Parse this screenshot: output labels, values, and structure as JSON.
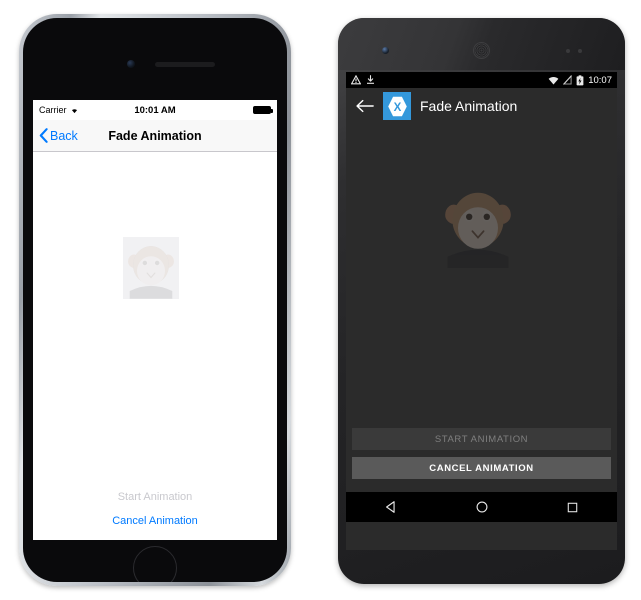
{
  "ios": {
    "status": {
      "carrier": "Carrier",
      "wifi_icon": "wifi-icon",
      "time": "10:01 AM",
      "battery_icon": "battery-icon"
    },
    "nav": {
      "back_label": "Back",
      "back_icon": "chevron-left-icon",
      "title": "Fade Animation"
    },
    "content": {
      "image_name": "monkey-image"
    },
    "buttons": {
      "start_label": "Start Animation",
      "start_enabled": false,
      "cancel_label": "Cancel Animation",
      "cancel_enabled": true
    },
    "colors": {
      "tint": "#007aff",
      "disabled_text": "#c9c9ce",
      "nav_bg": "#f8f8f8",
      "screen_bg": "#ffffff"
    },
    "hardware": {
      "camera": "camera-icon",
      "speaker": "speaker-grille",
      "home_button": "home-button"
    }
  },
  "android": {
    "status": {
      "warning_icon": "warning-triangle-icon",
      "download_icon": "download-icon",
      "wifi_icon": "wifi-icon",
      "signal_icon": "signal-off-icon",
      "battery_icon": "battery-charging-icon",
      "time": "10:07"
    },
    "toolbar": {
      "back_icon": "arrow-left-icon",
      "logo_name": "xamarin-logo-icon",
      "logo_letter": "X",
      "title": "Fade Animation"
    },
    "content": {
      "image_name": "monkey-image"
    },
    "buttons": {
      "start_label": "START ANIMATION",
      "start_enabled": false,
      "cancel_label": "CANCEL ANIMATION",
      "cancel_enabled": true
    },
    "navbar": {
      "back_icon": "nav-back-triangle-icon",
      "home_icon": "nav-home-circle-icon",
      "recents_icon": "nav-recents-square-icon"
    },
    "colors": {
      "accent": "#3498db",
      "screen_bg": "#2b2b2b",
      "status_bg": "#000000",
      "btn_disabled_bg": "#3a3a3a",
      "btn_enabled_bg": "#5a5a5a"
    },
    "hardware": {
      "camera": "camera-icon",
      "speaker": "speaker-grille",
      "sensors": "sensor-dots"
    }
  }
}
